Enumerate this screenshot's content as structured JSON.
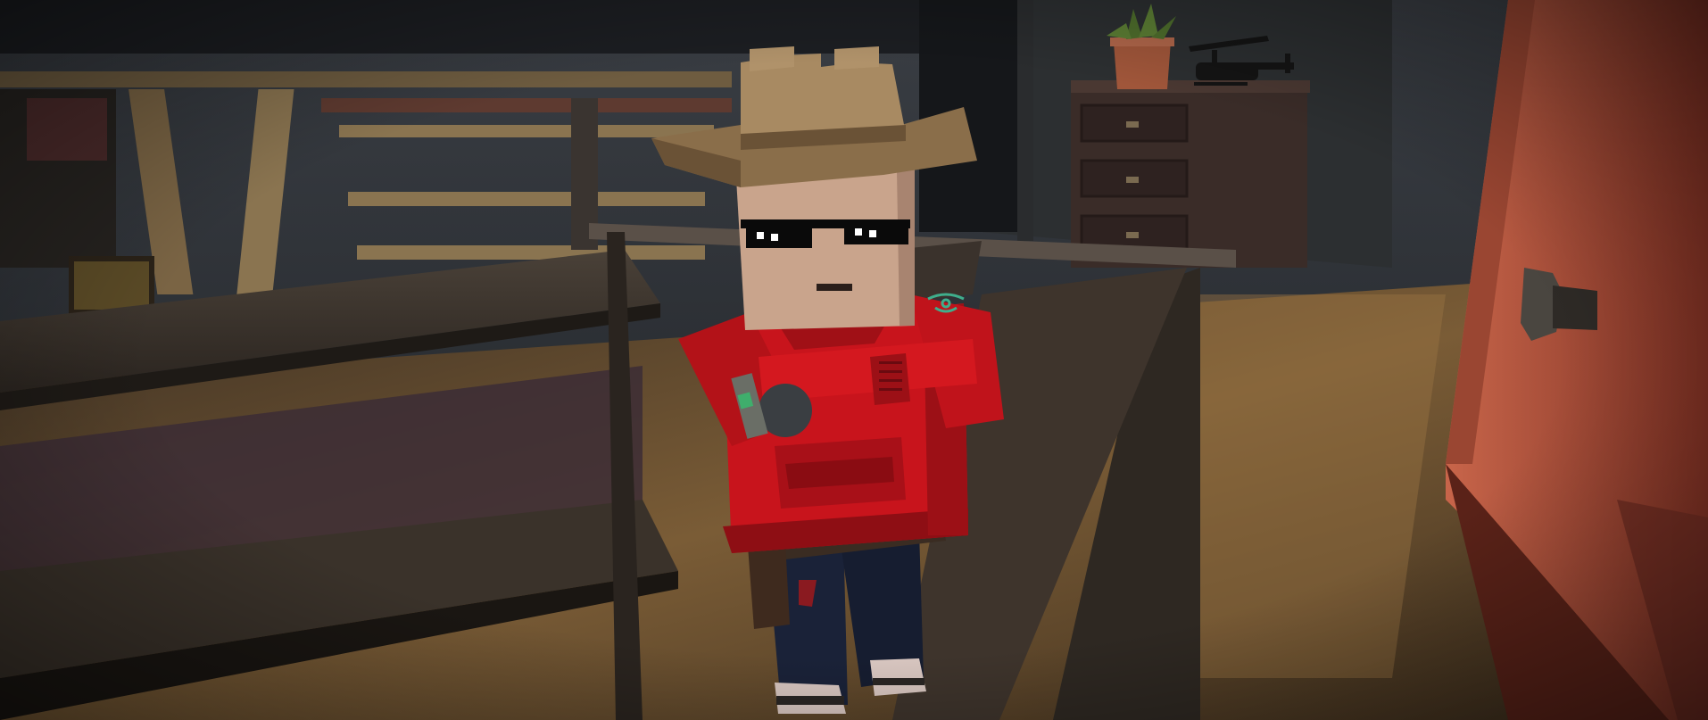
{
  "scene": {
    "description_colors": {
      "wall_dark": "#2a2e33",
      "wood_light": "#8a7450",
      "wood_dark": "#3a322a",
      "floor": "#6b5232",
      "hoodie_red": "#c8141c",
      "hat_tan": "#9c7e58",
      "door_orange": "#b5533c",
      "skin": "#c9a48c",
      "jeans": "#1a2238",
      "plant_green": "#4e6e2c",
      "pot_terracotta": "#a0563a",
      "emblem_teal": "#3fae8c"
    },
    "objects": {
      "character": "blocky-cowboy-character",
      "hat_icon": "cowboy-hat-icon",
      "glasses_icon": "pixel-sunglasses-icon",
      "helicopter_icon": "toy-helicopter-icon",
      "plant_icon": "potted-plant-icon",
      "door_knob_icon": "door-knob-icon"
    }
  }
}
